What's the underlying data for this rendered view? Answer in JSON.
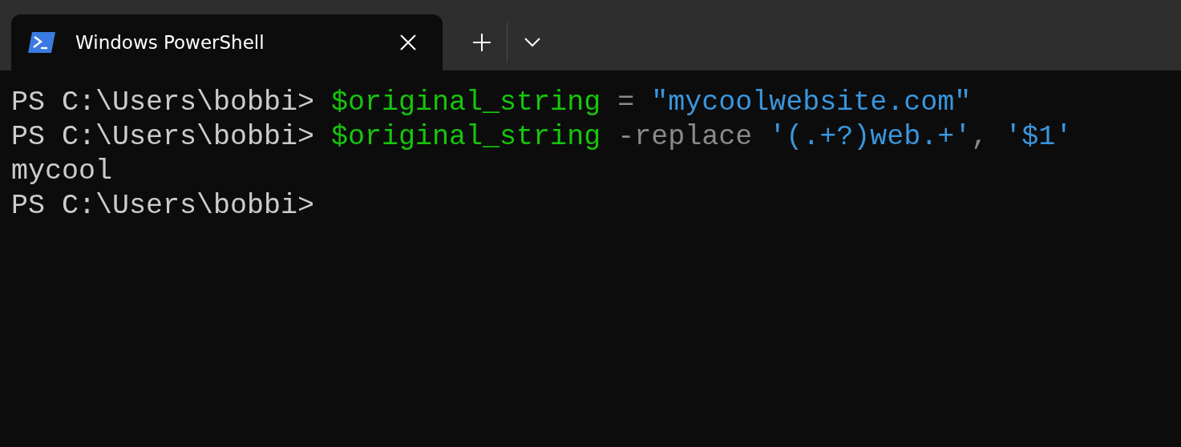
{
  "tabs": [
    {
      "title": "Windows PowerShell",
      "selected": true
    }
  ],
  "lines": [
    {
      "segments": [
        {
          "text": "PS C:\\Users\\bobbi> ",
          "kind": "prompt"
        },
        {
          "text": "$original_string",
          "kind": "variable"
        },
        {
          "text": " = ",
          "kind": "operator"
        },
        {
          "text": "\"mycoolwebsite.com\"",
          "kind": "string"
        }
      ]
    },
    {
      "segments": [
        {
          "text": "PS C:\\Users\\bobbi> ",
          "kind": "prompt"
        },
        {
          "text": "$original_string",
          "kind": "variable"
        },
        {
          "text": " -replace ",
          "kind": "operator"
        },
        {
          "text": "'(.+?)web.+'",
          "kind": "string"
        },
        {
          "text": ", ",
          "kind": "operator"
        },
        {
          "text": "'$1'",
          "kind": "string"
        }
      ]
    },
    {
      "segments": [
        {
          "text": "mycool",
          "kind": "output"
        }
      ]
    },
    {
      "segments": [
        {
          "text": "PS C:\\Users\\bobbi>",
          "kind": "prompt"
        }
      ]
    }
  ]
}
